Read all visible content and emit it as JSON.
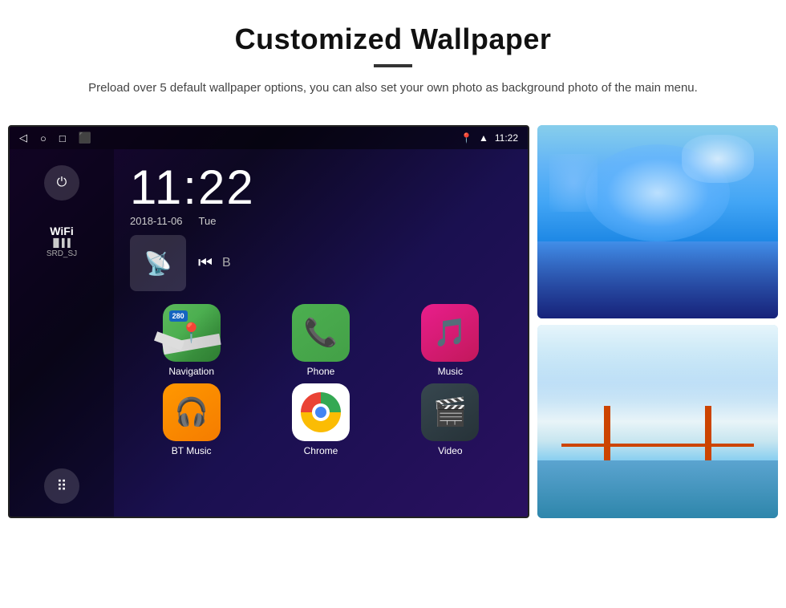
{
  "header": {
    "title": "Customized Wallpaper",
    "description": "Preload over 5 default wallpaper options, you can also set your own photo as background photo of the main menu."
  },
  "android": {
    "statusBar": {
      "time": "11:22",
      "icons": [
        "◁",
        "○",
        "□",
        "⬛"
      ]
    },
    "clock": {
      "time": "11:22",
      "date": "2018-11-06",
      "day": "Tue"
    },
    "wifi": {
      "label": "WiFi",
      "ssid": "SRD_SJ"
    },
    "apps": [
      {
        "name": "Navigation",
        "type": "nav"
      },
      {
        "name": "Phone",
        "type": "phone"
      },
      {
        "name": "Music",
        "type": "music"
      },
      {
        "name": "BT Music",
        "type": "bt"
      },
      {
        "name": "Chrome",
        "type": "chrome"
      },
      {
        "name": "Video",
        "type": "video"
      }
    ]
  }
}
